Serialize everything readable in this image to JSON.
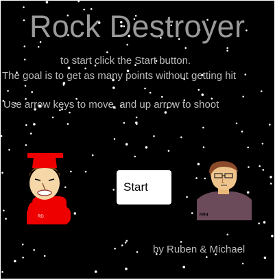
{
  "title": "Rock Destroyer",
  "instructions": {
    "line1": "to start click the Start button.",
    "line2": "The goal is to get as many points without getting hit",
    "line3": "Use arrow keys to move, and up arrow to shoot"
  },
  "start_button": {
    "label": "Start"
  },
  "credits": "by Ruben & Michael",
  "avatars": {
    "left": {
      "badge": "RD",
      "icon": "red-cap-character-icon"
    },
    "right": {
      "shirt_text": "MMH",
      "icon": "glasses-character-icon"
    }
  },
  "colors": {
    "background": "#000000",
    "title": "#9a9a9a",
    "text": "#bdbdbd",
    "button": "#ffffff",
    "star": "#ffffff",
    "red": "#ee0000",
    "shirt": "#6b4a5a"
  }
}
